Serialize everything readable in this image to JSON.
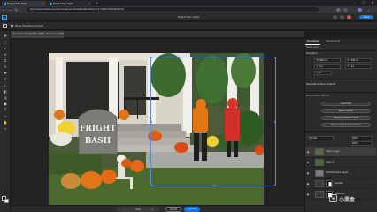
{
  "browser": {
    "tab_title": "Project Turn Style",
    "tab_title_2": "Project Turn Style",
    "url": "photoshop.adobe.com/id/urn:aaid:sc:US:a4ba4f2e-9d03-4c17-8a8c-6f0d3bbf2c41",
    "colors": {
      "chrome_bg": "#202124",
      "tab_active": "#35363a",
      "accent": "#31a8ff"
    }
  },
  "app": {
    "logo": "Ps",
    "title": "Project Turn Style",
    "share_label": "Share"
  },
  "options_bar": {
    "show_transform_controls": "Show Transform Controls",
    "checked": true
  },
  "document": {
    "tab_label": "pumpkin.psd @ 51% (Style, 32 Layers, RGB/8)",
    "canvas_sign_line1": "FRIGHT",
    "canvas_sign_line2": "BASH"
  },
  "status_bar": {
    "zoom": "51%",
    "cancel_label": "Cancel",
    "commit_label": "Commit"
  },
  "panels": {
    "tabs": [
      "Properties",
      "Adjustments"
    ],
    "active_tab": "Properties",
    "subheading": "Pixel Layer",
    "transform": {
      "heading": "Transform",
      "w": "W 1800 px",
      "h": "H 1200 px",
      "x": "X 0 px",
      "y": "Y 0 px",
      "angle": "0.00°"
    },
    "remove_section": {
      "heading": "Generative Style Variants",
      "heading2": "Neural filter options",
      "buttons": [
        "Load Filter",
        "Reset Canvas",
        "Download Result Frame",
        "Download Sharpened Frame"
      ]
    },
    "layers": {
      "blend_mode": "Normal",
      "opacity": "100%",
      "fill": "100%",
      "items": [
        {
          "name": "Layer 2 copy",
          "selected": true
        },
        {
          "name": "Layer 2"
        },
        {
          "name": "Transformation Layer",
          "has_mask": false
        },
        {
          "name": "Hue/Sat",
          "has_mask": true
        },
        {
          "name": "Reflection",
          "has_mask": true
        }
      ]
    }
  },
  "watermark": "小黑盒"
}
